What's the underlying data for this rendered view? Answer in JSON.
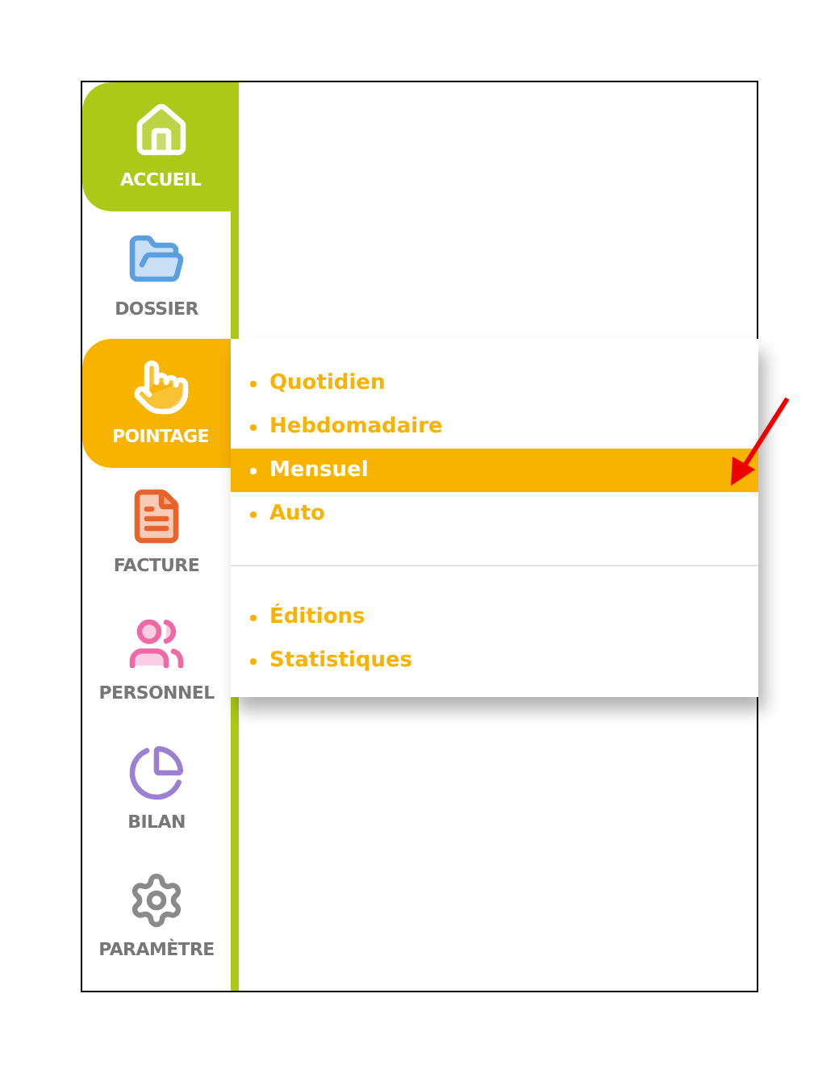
{
  "sidebar": {
    "items": [
      {
        "label": "ACCUEIL",
        "kind": "home",
        "color": "#acc918",
        "selected": true
      },
      {
        "label": "DOSSIER",
        "kind": "folder",
        "color": "#5b9fe0",
        "selected": false
      },
      {
        "label": "POINTAGE",
        "kind": "touch",
        "color": "#f8b200",
        "selected": true
      },
      {
        "label": "FACTURE",
        "kind": "invoice",
        "color": "#e8632a",
        "selected": false
      },
      {
        "label": "PERSONNEL",
        "kind": "people",
        "color": "#ee6aa7",
        "selected": false
      },
      {
        "label": "BILAN",
        "kind": "pie",
        "color": "#9b7fd1",
        "selected": false
      },
      {
        "label": "PARAMÈTRE",
        "kind": "gear",
        "color": "#8a8a8a",
        "selected": false
      }
    ]
  },
  "menu": {
    "groups": [
      [
        {
          "label": "Quotidien",
          "selected": false
        },
        {
          "label": "Hebdomadaire",
          "selected": false
        },
        {
          "label": "Mensuel",
          "selected": true
        },
        {
          "label": "Auto",
          "selected": false
        }
      ],
      [
        {
          "label": "Éditions",
          "selected": false
        },
        {
          "label": "Statistiques",
          "selected": false
        }
      ]
    ]
  }
}
